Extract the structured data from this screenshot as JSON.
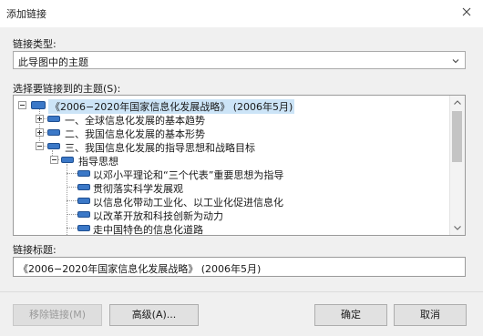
{
  "dialog": {
    "title": "添加链接",
    "close_icon": "close-icon"
  },
  "link_type": {
    "label": "链接类型:",
    "selected": "此导图中的主题"
  },
  "tree": {
    "label": "选择要链接到的主题(S):",
    "nodes": [
      "《2006−2020年国家信息化发展战略》 (2006年5月)",
      "一、全球信息化发展的基本趋势",
      "二、我国信息化发展的基本形势",
      "三、我国信息化发展的指导思想和战略目标",
      "指导思想",
      "以邓小平理论和“三个代表”重要思想为指导",
      "贯彻落实科学发展观",
      "以信息化带动工业化、以工业化促进信息化",
      "以改革开放和科技创新为动力",
      "走中国特色的信息化道路"
    ]
  },
  "link_title": {
    "label": "链接标题:",
    "value": "《2006−2020年国家信息化发展战略》 (2006年5月)"
  },
  "buttons": {
    "remove": "移除链接(M)",
    "advanced": "高级(A)...",
    "ok": "确定",
    "cancel": "取消"
  },
  "colors": {
    "topic_fill": "#3b78c7",
    "selection": "#cce4f7"
  }
}
